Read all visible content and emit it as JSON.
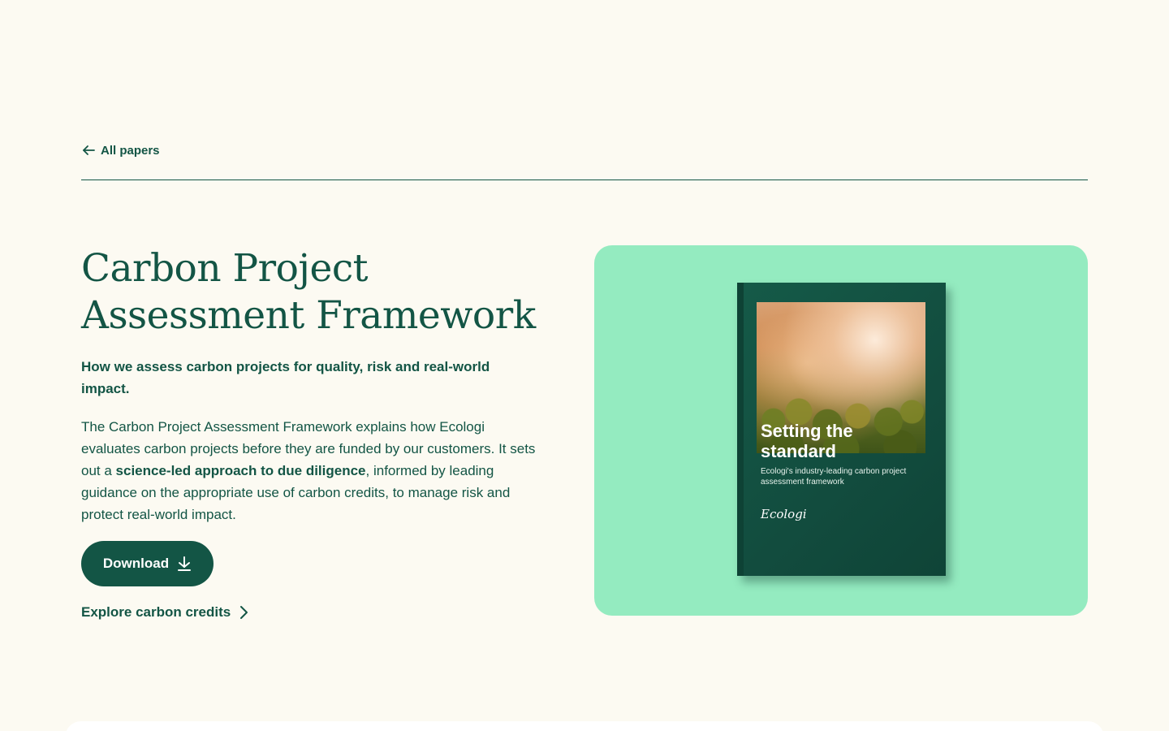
{
  "nav": {
    "back_label": "All papers"
  },
  "hero": {
    "title": "Carbon Project Assessment Framework",
    "subtitle": "How we assess carbon projects for quality, risk and real-world impact.",
    "body_part1": "The Carbon Project Assessment Framework explains how Ecologi evaluates carbon projects before they are funded by our customers. It sets out a ",
    "body_bold": "science-led approach to due diligence",
    "body_part2": ", informed by leading guidance on the appropriate use of carbon credits, to manage risk and protect real-world impact.",
    "download_label": "Download",
    "explore_label": "Explore carbon credits"
  },
  "book": {
    "title": "Setting the standard",
    "subtitle": "Ecologi's industry-leading carbon project assessment framework",
    "logo": "Ecologi"
  },
  "colors": {
    "brand_dark_green": "#135545",
    "page_background": "#fcfaf2",
    "card_mint": "#94ebc0"
  },
  "icons": {
    "back": "arrow-left-icon",
    "download": "download-icon",
    "explore": "chevron-right-icon"
  }
}
